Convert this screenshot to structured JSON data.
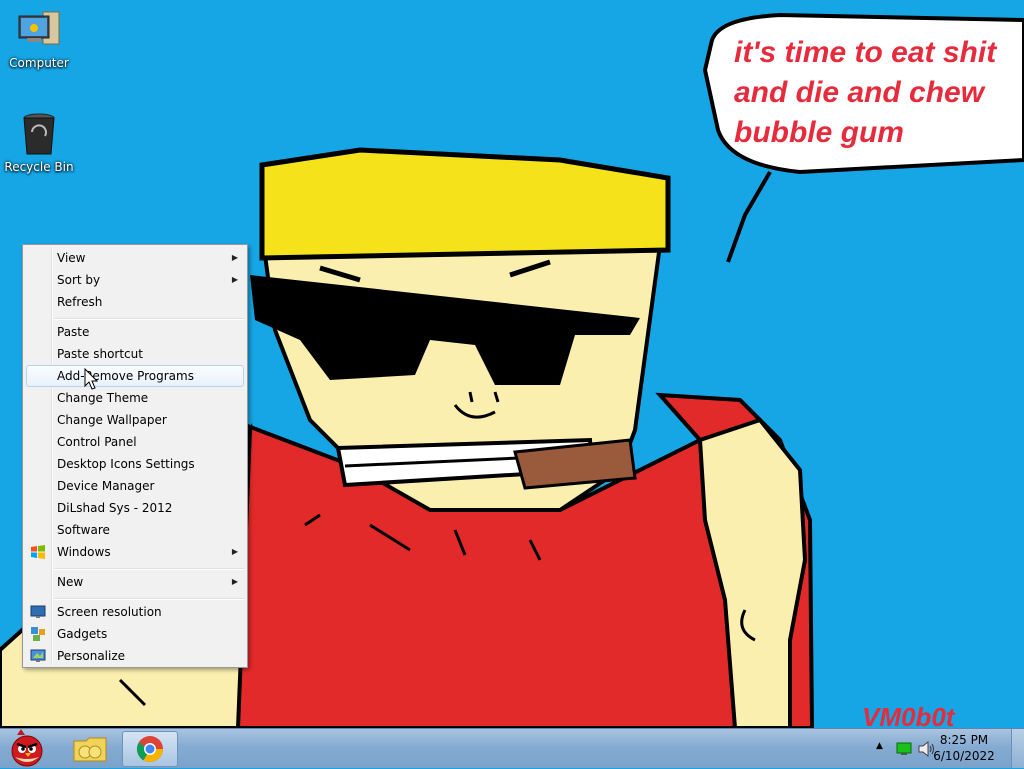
{
  "desktop": {
    "icons": [
      {
        "label": "Computer"
      },
      {
        "label": "Recycle Bin"
      }
    ],
    "wallpaper": {
      "speech": [
        "it's time to eat shit",
        "and die and chew",
        "bubble gum"
      ],
      "signature": "VM0b0t"
    }
  },
  "context_menu": {
    "items": [
      {
        "label": "View",
        "submenu": true
      },
      {
        "label": "Sort by",
        "submenu": true
      },
      {
        "label": "Refresh"
      },
      {
        "label": "Paste"
      },
      {
        "label": "Paste shortcut"
      },
      {
        "label": "Add-Remove Programs",
        "highlighted": true
      },
      {
        "label": "Change Theme"
      },
      {
        "label": "Change Wallpaper"
      },
      {
        "label": "Control Panel"
      },
      {
        "label": "Desktop Icons Settings"
      },
      {
        "label": "Device Manager"
      },
      {
        "label": "DiLshad Sys - 2012"
      },
      {
        "label": "Software"
      },
      {
        "label": "Windows",
        "submenu": true,
        "icon": "windows-logo-icon"
      },
      {
        "label": "New",
        "submenu": true
      },
      {
        "label": "Screen resolution",
        "icon": "screen-resolution-icon"
      },
      {
        "label": "Gadgets",
        "icon": "gadgets-icon"
      },
      {
        "label": "Personalize",
        "icon": "personalize-icon"
      }
    ]
  },
  "taskbar": {
    "start_icon": "angry-bird-icon",
    "pinned": [
      "file-explorer-icon",
      "chrome-icon"
    ],
    "clock": {
      "time": "8:25 PM",
      "date": "6/10/2022"
    }
  },
  "colors": {
    "desktop_bg": "#16a6e6",
    "shirt": "#e32a2a",
    "hair": "#f5e21b",
    "skin": "#fbefb0",
    "speech_text": "#e62b3c"
  }
}
